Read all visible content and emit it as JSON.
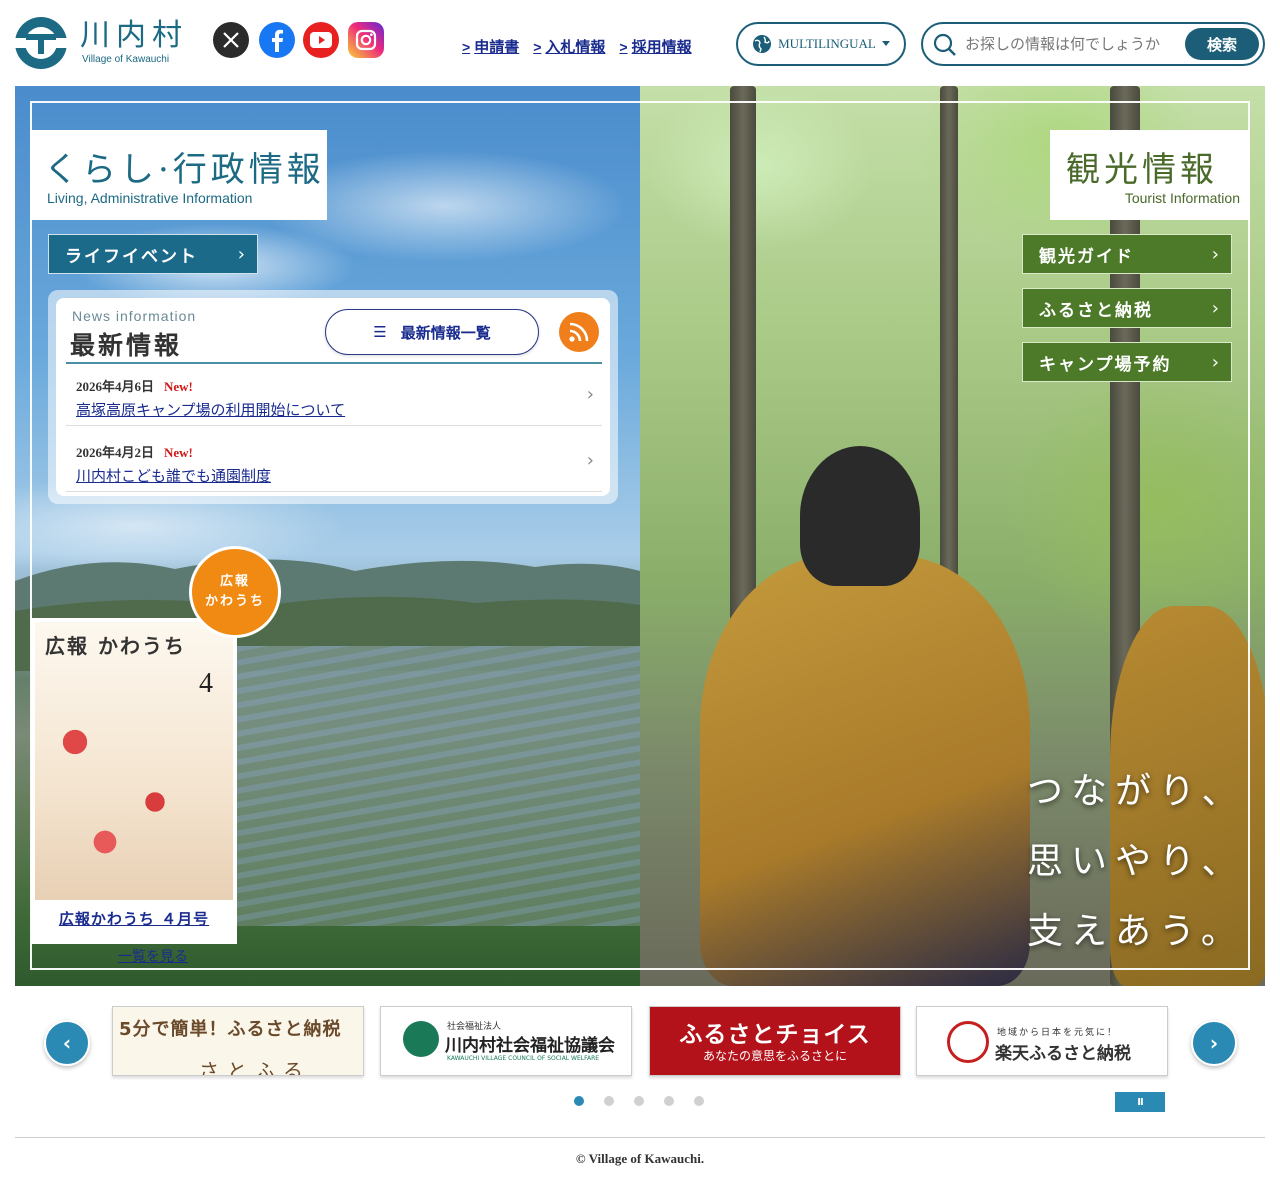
{
  "header": {
    "logo_ja": "川内村",
    "logo_en": "Village of Kawauchi",
    "sns": [
      "x-icon",
      "facebook-icon",
      "youtube-icon",
      "instagram-icon"
    ],
    "links": [
      "申請書",
      "入札情報",
      "採用情報"
    ],
    "multilingual": "MULTILINGUAL",
    "search_placeholder": "お探しの情報は何でしょうか",
    "search_button": "検索"
  },
  "left": {
    "title_ja": "くらし·行政情報",
    "title_en": "Living, Administrative Information",
    "life_event": "ライフイベント"
  },
  "news": {
    "label_en": "News information",
    "label_ja": "最新情報",
    "all_button": "最新情報一覧",
    "items": [
      {
        "date": "2026年4月6日",
        "badge": "New!",
        "title": "高塚高原キャンプ場の利用開始について"
      },
      {
        "date": "2026年4月2日",
        "badge": "New!",
        "title": "川内村こども誰でも通園制度"
      }
    ]
  },
  "kouhou": {
    "badge_line1": "広報",
    "badge_line2": "かわうち",
    "cover_masthead": "広報 かわうち",
    "cover_issue": "4",
    "label": "広報かわうち ４月号",
    "more": "一覧を見る"
  },
  "right": {
    "title_ja": "観光情報",
    "title_en": "Tourist Information",
    "buttons": [
      "観光ガイド",
      "ふるさと納税",
      "キャンプ場予約"
    ],
    "catch": [
      "つながり、",
      "思いやり、",
      "支えあう。"
    ]
  },
  "banners": {
    "b1_title": "5分で簡単！ふるさと納税",
    "b1_sub": "さとふる",
    "b2_sub": "社会福祉法人",
    "b2_title": "川内村社会福祉協議会",
    "b2_en": "KAWAUCHI VILLAGE COUNCIL OF SOCIAL WELFARE",
    "b3_title": "ふるさとチョイス",
    "b3_sub": "あなたの意思をふるさとに",
    "b4_sub": "地域から日本を元気に！",
    "b4_title": "楽天ふるさと納税",
    "prev": "‹",
    "next": "›",
    "pause": "II",
    "active_dot": 1,
    "dot_count": 5
  },
  "footer": {
    "copyright": "© Village of Kawauchi."
  }
}
